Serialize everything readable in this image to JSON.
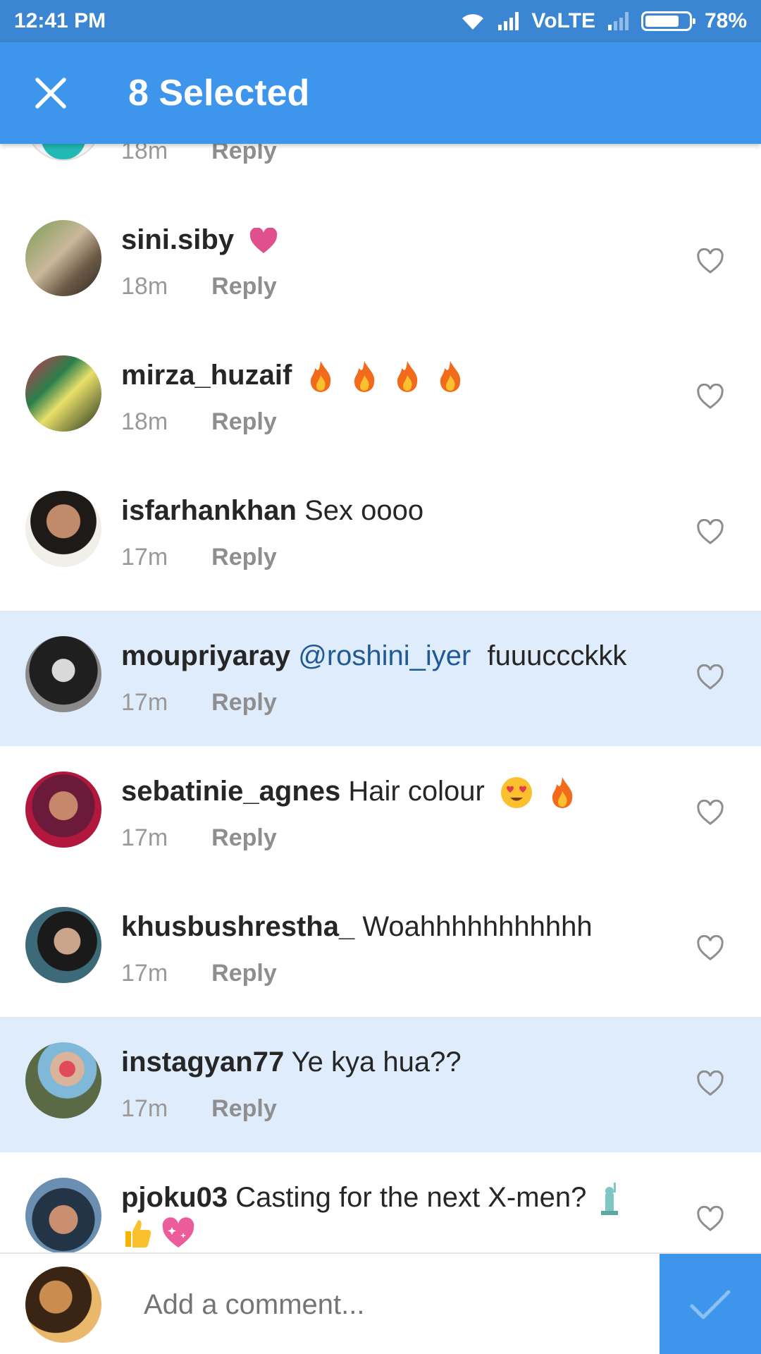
{
  "status_bar": {
    "time": "12:41 PM",
    "network_label": "VoLTE",
    "battery_percent_label": "78%",
    "battery_level": 0.78
  },
  "app_bar": {
    "title": "8 Selected",
    "close_icon": "close-icon"
  },
  "colors": {
    "status_bar": "#3a86d3",
    "app_bar": "#3d96eb",
    "selected_row": "#dfecfb",
    "mention": "#1f5a96"
  },
  "comments": [
    {
      "username": "",
      "text": "",
      "time": "18m",
      "reply": "Reply",
      "selected": false,
      "emojis": []
    },
    {
      "username": "sini.siby",
      "text": "",
      "time": "18m",
      "reply": "Reply",
      "selected": false,
      "emojis": [
        "pink-heart"
      ]
    },
    {
      "username": "mirza_huzaif",
      "text": "",
      "time": "18m",
      "reply": "Reply",
      "selected": false,
      "emojis": [
        "fire",
        "fire",
        "fire",
        "fire"
      ]
    },
    {
      "username": "isfarhankhan",
      "text": "Sex oooo",
      "time": "17m",
      "reply": "Reply",
      "selected": false,
      "emojis": []
    },
    {
      "username": "moupriyaray",
      "mention": "@roshini_iyer",
      "text": "fuuuccckkk",
      "time": "17m",
      "reply": "Reply",
      "selected": true,
      "emojis": []
    },
    {
      "username": "sebatinie_agnes",
      "text": "Hair colour",
      "time": "17m",
      "reply": "Reply",
      "selected": false,
      "emojis": [
        "heart-eyes",
        "fire"
      ]
    },
    {
      "username": "khusbushrestha_",
      "text": "Woahhhhhhhhhhh",
      "time": "17m",
      "reply": "Reply",
      "selected": false,
      "emojis": []
    },
    {
      "username": "instagyan77",
      "text": "Ye kya hua??",
      "time": "17m",
      "reply": "Reply",
      "selected": true,
      "emojis": []
    },
    {
      "username": "pjoku03",
      "text": "Casting for the next X-men?",
      "time": "",
      "reply": "",
      "selected": false,
      "emojis": [
        "statue-of-liberty",
        "thumbs-up",
        "sparkling-heart"
      ]
    }
  ],
  "comment_bar": {
    "placeholder": "Add a comment...",
    "send_icon": "checkmark-icon"
  }
}
